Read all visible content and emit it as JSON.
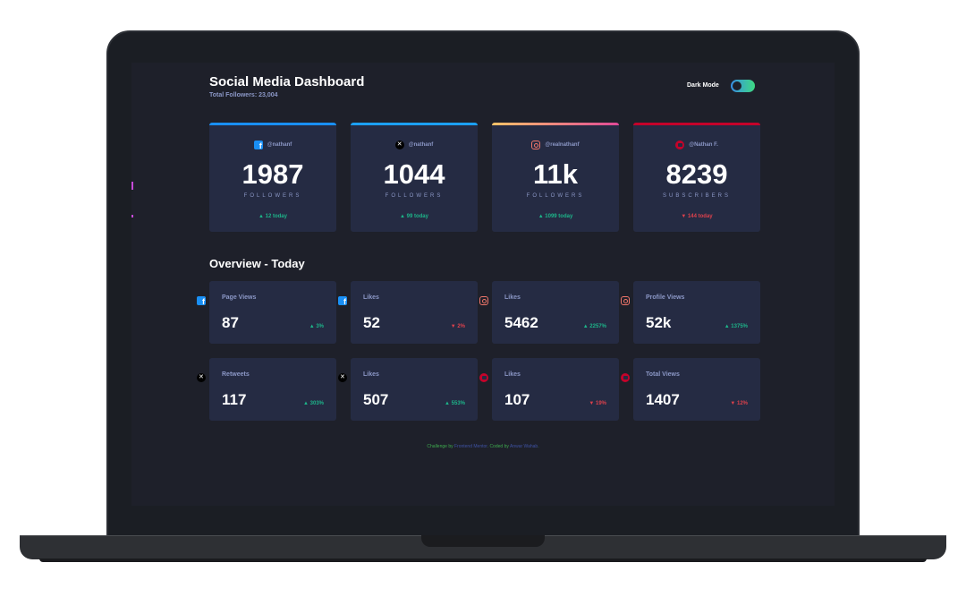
{
  "header": {
    "title": "Social Media Dashboard",
    "total_followers": "Total Followers: 23,004",
    "dark_mode_label": "Dark Mode"
  },
  "cards": [
    {
      "network": "facebook",
      "icon": "facebook-icon",
      "handle": "@nathanf",
      "count": "1987",
      "label": "FOLLOWERS",
      "change": "▲ 12 today",
      "direction": "up",
      "accent": "#198ff5"
    },
    {
      "network": "x",
      "icon": "x-icon",
      "handle": "@nathanf",
      "count": "1044",
      "label": "FOLLOWERS",
      "change": "▲ 99 today",
      "direction": "up",
      "accent": "#1ca0f2"
    },
    {
      "network": "instagram",
      "icon": "instagram-icon",
      "handle": "@realnathanf",
      "count": "11k",
      "label": "FOLLOWERS",
      "change": "▲ 1099 today",
      "direction": "up",
      "accent": "#fdc468"
    },
    {
      "network": "youtube",
      "icon": "youtube-icon",
      "handle": "@Nathan F.",
      "count": "8239",
      "label": "SUBSCRIBERS",
      "change": "▼ 144 today",
      "direction": "down",
      "accent": "#c4032a"
    }
  ],
  "overview": {
    "title": "Overview - Today",
    "items": [
      {
        "label": "Page Views",
        "icon": "facebook-icon",
        "value": "87",
        "change": "▲ 3%",
        "direction": "up"
      },
      {
        "label": "Likes",
        "icon": "facebook-icon",
        "value": "52",
        "change": "▼ 2%",
        "direction": "down"
      },
      {
        "label": "Likes",
        "icon": "instagram-icon",
        "value": "5462",
        "change": "▲ 2257%",
        "direction": "up"
      },
      {
        "label": "Profile Views",
        "icon": "instagram-icon",
        "value": "52k",
        "change": "▲ 1375%",
        "direction": "up"
      },
      {
        "label": "Retweets",
        "icon": "x-icon",
        "value": "117",
        "change": "▲ 303%",
        "direction": "up"
      },
      {
        "label": "Likes",
        "icon": "x-icon",
        "value": "507",
        "change": "▲ 553%",
        "direction": "up"
      },
      {
        "label": "Likes",
        "icon": "youtube-icon",
        "value": "107",
        "change": "▼ 19%",
        "direction": "down"
      },
      {
        "label": "Total Views",
        "icon": "youtube-icon",
        "value": "1407",
        "change": "▼ 12%",
        "direction": "down"
      }
    ]
  },
  "footer": {
    "prefix": "Challenge by",
    "link1": "Frontend Mentor",
    "middle": ". Coded by",
    "link2": "Anwar Wahab",
    "suffix": "."
  },
  "colors": {
    "up": "#1db489",
    "down": "#dc414c",
    "toggle_gradient": [
      "#378fe6",
      "#3eda82"
    ]
  }
}
